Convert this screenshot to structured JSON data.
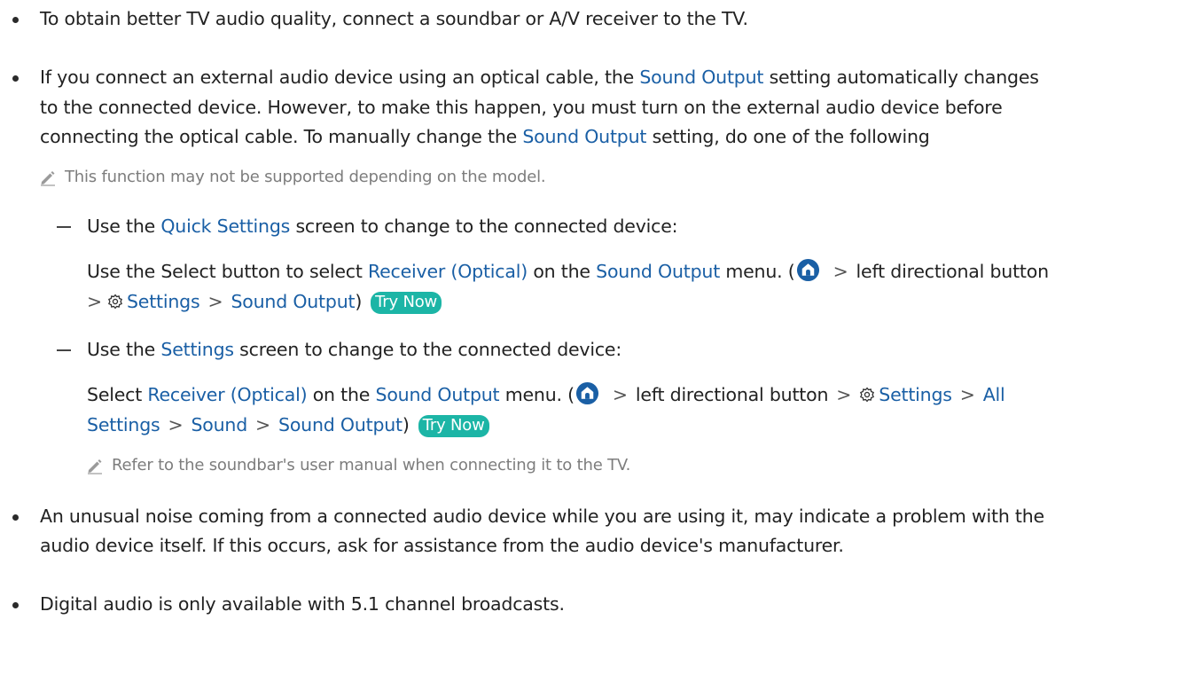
{
  "content": {
    "b1": {
      "text": "To obtain better TV audio quality, connect a soundbar or A/V receiver to the TV."
    },
    "b2": {
      "l1_a": "If you connect an external audio device using an optical cable, the ",
      "sound_output": "Sound Output",
      "l1_b": " setting automatically changes",
      "l2": "to the connected device. However, to make this happen, you must turn on the external audio device before",
      "l3_a": "connecting the optical cable. To manually change the ",
      "l3_b": " setting, do one of the following"
    },
    "note1": "This function may not be supported depending on the model.",
    "d1": {
      "a": "Use the ",
      "quick_settings": "Quick Settings",
      "b": " screen to change to the connected device:"
    },
    "d1_body": {
      "a": "Use the Select button to select ",
      "receiver": "Receiver (Optical)",
      "b": " on the ",
      "sound_output": "Sound Output",
      "c": " menu. (",
      "d": "left directional button",
      "settings": "Settings",
      "close": ")"
    },
    "try_now": "Try Now",
    "d2": {
      "a": "Use the ",
      "settings": "Settings",
      "b": " screen to change to the connected device:"
    },
    "d2_body": {
      "a": "Select ",
      "receiver": "Receiver (Optical)",
      "b": " on the ",
      "sound_output": "Sound Output",
      "c": " menu. (",
      "d": "left directional button",
      "settings": "Settings",
      "all": "All",
      "settings2": "Settings",
      "sound": "Sound",
      "close": ")"
    },
    "note2": "Refer to the soundbar's user manual when connecting it to the TV.",
    "b3": {
      "l1": "An unusual noise coming from a connected audio device while you are using it, may indicate a problem with the",
      "l2": "audio device itself. If this occurs, ask for assistance from the audio device's manufacturer."
    },
    "b4": {
      "text": "Digital audio is only available with 5.1 channel broadcasts."
    },
    "separator": ">"
  },
  "colors": {
    "link": "#1a5fa5",
    "try_now_bg": "#1cb5a6",
    "note": "#7d7d7d",
    "body": "#222222"
  },
  "icons": [
    "home-icon",
    "gear-icon",
    "pencil-icon",
    "chevron-right-icon"
  ]
}
